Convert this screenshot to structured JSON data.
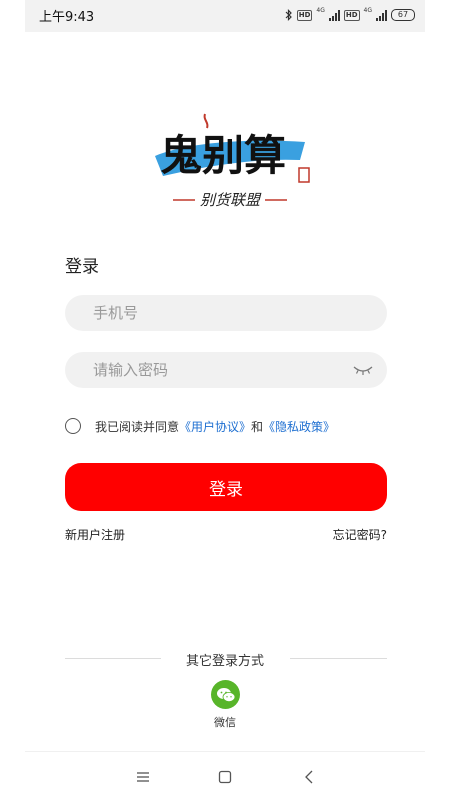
{
  "status": {
    "time": "上午9:43",
    "battery": "67",
    "net1": "4G",
    "net2": "4G",
    "hd": "HD"
  },
  "logo": {
    "name": "鬼别算",
    "slogan": "别货联盟"
  },
  "login": {
    "title": "登录",
    "phone_placeholder": "手机号",
    "password_placeholder": "请输入密码",
    "agree_prefix": "我已阅读并同意",
    "user_agreement": "《用户协议》",
    "and": "和",
    "privacy_policy": "《隐私政策》",
    "button": "登录",
    "register": "新用户注册",
    "forgot": "忘记密码?"
  },
  "other": {
    "title": "其它登录方式",
    "wechat": "微信"
  },
  "colors": {
    "primary": "#ff0000",
    "link": "#1e6fd1",
    "wechat": "#58b52a"
  }
}
